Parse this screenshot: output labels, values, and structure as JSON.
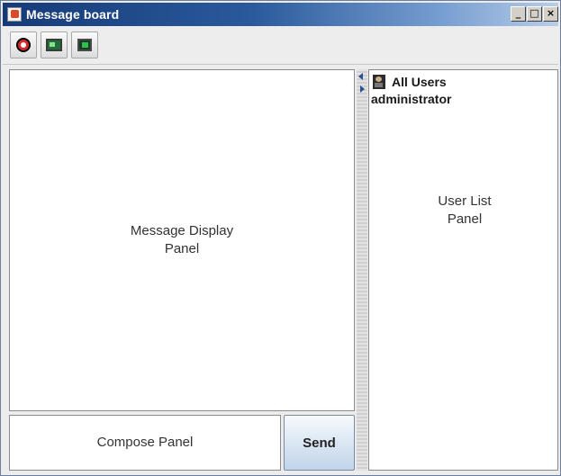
{
  "window": {
    "title": "Message board",
    "controls": [
      "_",
      "□",
      "×"
    ]
  },
  "toolbar": {
    "buttons": [
      {
        "icon": "logout-icon"
      },
      {
        "icon": "monitor-icon"
      },
      {
        "icon": "screen-icon"
      }
    ]
  },
  "message_panel": {
    "label": "Message Display\nPanel"
  },
  "compose_panel": {
    "label": "Compose Panel"
  },
  "send_button": {
    "label": "Send"
  },
  "user_list": {
    "header": "All Users",
    "users": [
      "administrator"
    ],
    "label": "User List\nPanel"
  }
}
